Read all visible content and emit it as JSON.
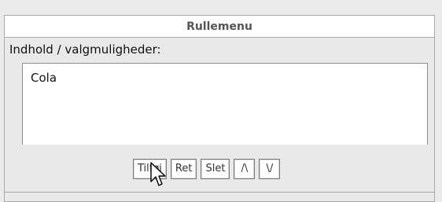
{
  "panel": {
    "title": "Rullemenu",
    "field_label": "Indhold / valgmuligheder:",
    "options": [
      "Cola"
    ]
  },
  "buttons": {
    "add": "Tilføj",
    "edit": "Ret",
    "delete": "Slet",
    "move_up": "/\\",
    "move_down": "\\/"
  },
  "colors": {
    "panel_bg": "#e9e9e9",
    "title_text": "#555555",
    "border": "#a9a9a9"
  },
  "icons": {
    "cursor": "mouse-pointer-icon"
  }
}
